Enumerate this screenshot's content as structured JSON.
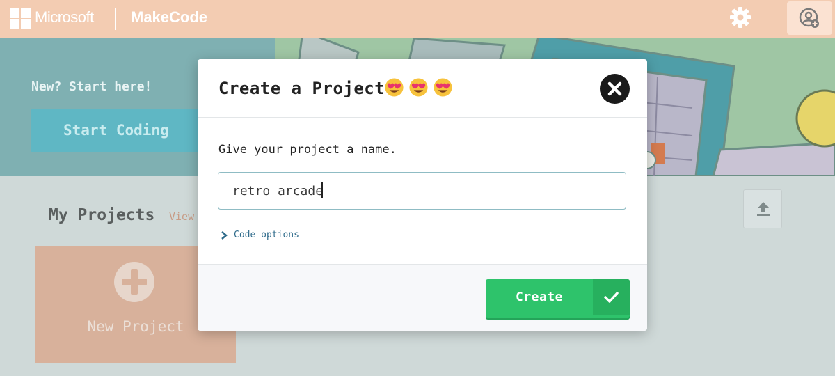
{
  "header": {
    "microsoft_label": "Microsoft",
    "product_label": "MakeCode",
    "settings_icon": "gear-icon",
    "user_icon": "user-add-icon"
  },
  "hero": {
    "new_label": "New? Start here!",
    "start_button": "Start Coding"
  },
  "projects": {
    "title": "My Projects",
    "view_all": "View",
    "new_project_label": "New Project",
    "upload_icon": "upload-icon"
  },
  "modal": {
    "title": "Create a Project",
    "emoji": "😍",
    "prompt": "Give your project a name.",
    "name_value": "retro arcade",
    "code_options_label": "Code options",
    "create_label": "Create",
    "close_icon": "close-icon",
    "check_icon": "check-icon"
  },
  "colors": {
    "header_bg": "#f3ccb2",
    "create_green": "#2ec36b",
    "hero_bg": "#7fb0b2"
  }
}
